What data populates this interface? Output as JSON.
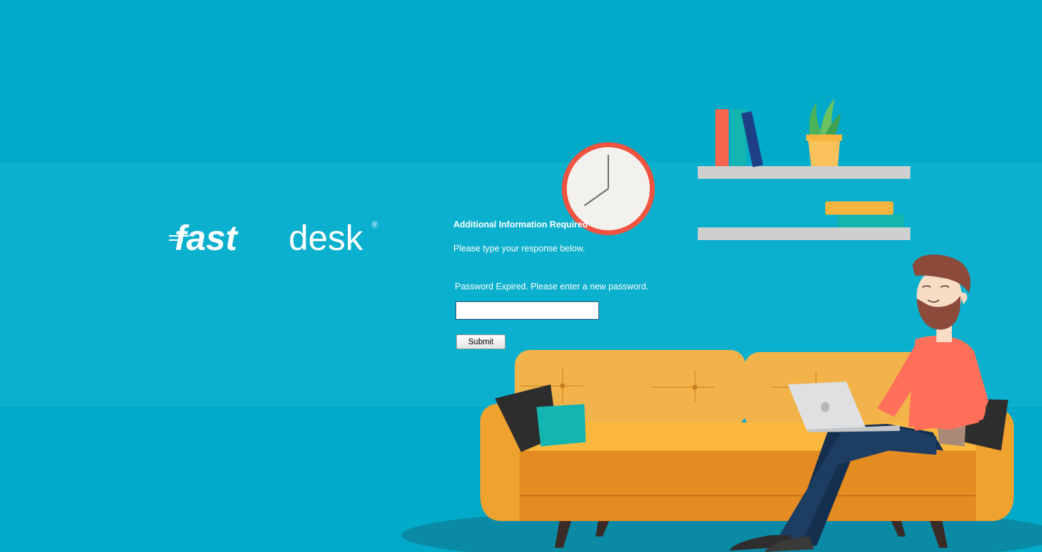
{
  "brand": {
    "logo_text_fast": "fast",
    "logo_text_desk": "desk",
    "logo_mark": "®"
  },
  "form": {
    "title": "Additional Information Required",
    "subtitle": "Please type your response below.",
    "prompt": "Password Expired. Please enter a new password.",
    "password_value": "",
    "submit_label": "Submit"
  },
  "colors": {
    "background": "#0aaecb",
    "sofa": "#f6b23c",
    "shirt": "#ff6f5a",
    "clock_ring": "#f0533f"
  },
  "illustration": {
    "icons": [
      "clock-icon",
      "books-icon",
      "plant-icon",
      "sofa-icon",
      "laptop-icon",
      "person-icon"
    ]
  }
}
